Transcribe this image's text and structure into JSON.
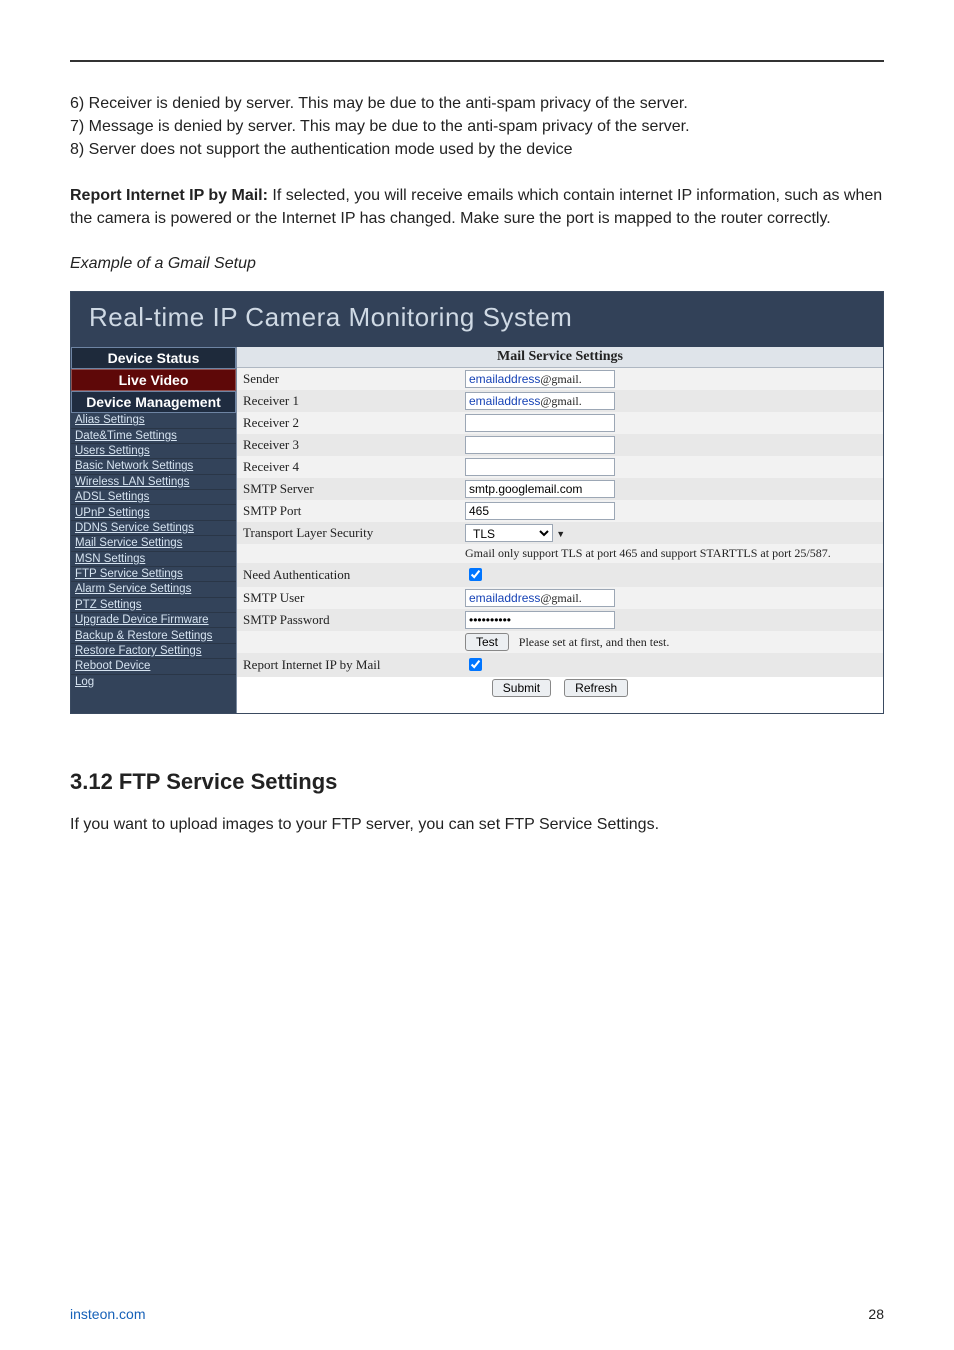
{
  "doc": {
    "bullets": [
      "6) Receiver is denied by server. This may be due to the anti-spam privacy of the server.",
      "7) Message is denied by server. This may be due to the anti-spam privacy of the server.",
      "8) Server does not support the authentication mode used by the device"
    ],
    "report_label": "Report Internet IP by Mail:",
    "report_text": " If selected, you will receive emails which contain internet IP information, such as when the camera is powered or the Internet IP has changed. Make sure the port is mapped to the router correctly.",
    "example_caption": "Example of a Gmail Setup",
    "section_title": "3.12 FTP Service Settings",
    "section_body": "If you want to upload images to your FTP server, you can set FTP Service Settings.",
    "footer_site": "insteon.com",
    "footer_page": "28"
  },
  "app": {
    "title": "Real-time IP Camera Monitoring System",
    "sidebar": {
      "device_status": "Device Status",
      "live_video": "Live Video",
      "device_management": "Device Management",
      "items": [
        "Alias Settings",
        "Date&Time Settings",
        "Users Settings",
        "Basic Network Settings",
        "Wireless LAN Settings",
        "ADSL Settings",
        "UPnP Settings",
        "DDNS Service Settings",
        "Mail Service Settings",
        "MSN Settings",
        "FTP Service Settings",
        "Alarm Service Settings",
        "PTZ Settings",
        "Upgrade Device Firmware",
        "Backup & Restore Settings",
        "Restore Factory Settings",
        "Reboot Device",
        "Log"
      ]
    },
    "form": {
      "title": "Mail Service Settings",
      "rows": {
        "sender_l": "Sender",
        "sender_pre": "emailaddress",
        "sender_suf": "@gmail.",
        "r1_l": "Receiver 1",
        "r1_pre": "emailaddress",
        "r1_suf": "@gmail.",
        "r2_l": "Receiver 2",
        "r3_l": "Receiver 3",
        "r4_l": "Receiver 4",
        "smtp_server_l": "SMTP Server",
        "smtp_server_v": "smtp.googlemail.com",
        "smtp_port_l": "SMTP Port",
        "smtp_port_v": "465",
        "tls_l": "Transport Layer Security",
        "tls_v": "TLS",
        "tls_hint": "Gmail only support TLS at port 465 and support STARTTLS at port 25/587.",
        "need_auth_l": "Need Authentication",
        "smtp_user_l": "SMTP User",
        "smtp_user_pre": "emailaddress",
        "smtp_user_suf": "@gmail.",
        "smtp_pwd_l": "SMTP Password",
        "smtp_pwd_v": "••••••••••",
        "test_btn": "Test",
        "test_hint": "Please set at first, and then test.",
        "report_l": "Report Internet IP by Mail",
        "submit_btn": "Submit",
        "refresh_btn": "Refresh"
      }
    }
  }
}
